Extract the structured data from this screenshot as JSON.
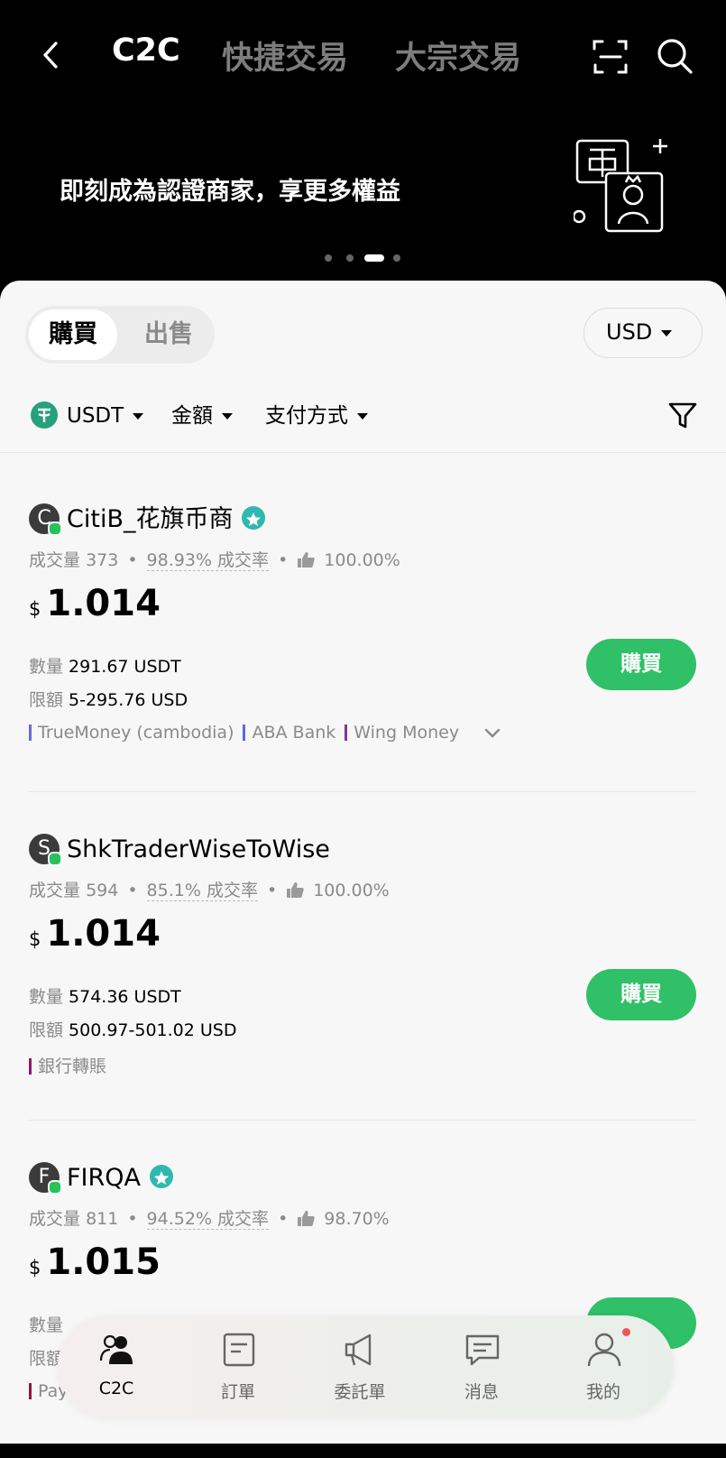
{
  "top_nav": {
    "tabs": [
      {
        "label": "C2C",
        "active": true
      },
      {
        "label": "快捷交易",
        "active": false
      },
      {
        "label": "大宗交易",
        "active": false
      }
    ]
  },
  "banner": {
    "text": "即刻成為認證商家，享更多權益",
    "pager": {
      "count": 4,
      "active_index": 2
    }
  },
  "trade_toggle": {
    "buy": "購買",
    "sell": "出售",
    "selected": "buy"
  },
  "currency_select": {
    "value": "USD"
  },
  "filters": {
    "coin": "USDT",
    "amount": "金額",
    "payment": "支付方式"
  },
  "offers": [
    {
      "avatar_letter": "C",
      "merchant": "CitiB_花旗币商",
      "verified": true,
      "trades_label": "成交量",
      "trades": "373",
      "completion": "98.93%",
      "completion_label": "成交率",
      "rating": "100.00%",
      "currency_symbol": "$",
      "price": "1.014",
      "quantity_label": "數量",
      "quantity": "291.67 USDT",
      "limit_label": "限額",
      "limit": "5-295.76 USD",
      "payments": [
        {
          "name": "TrueMoney (cambodia)",
          "color": "#6a6ad8"
        },
        {
          "name": "ABA Bank",
          "color": "#5a6ed6"
        },
        {
          "name": "Wing Money",
          "color": "#7a3a9a"
        }
      ],
      "expandable": true,
      "button": "購買"
    },
    {
      "avatar_letter": "S",
      "merchant": "ShkTraderWiseToWise",
      "verified": false,
      "trades_label": "成交量",
      "trades": "594",
      "completion": "85.1%",
      "completion_label": "成交率",
      "rating": "100.00%",
      "currency_symbol": "$",
      "price": "1.014",
      "quantity_label": "數量",
      "quantity": "574.36 USDT",
      "limit_label": "限額",
      "limit": "500.97-501.02 USD",
      "payments": [
        {
          "name": "銀行轉賬",
          "color": "#8a1a6a"
        }
      ],
      "expandable": false,
      "button": "購買"
    },
    {
      "avatar_letter": "F",
      "merchant": "FIRQA",
      "verified": true,
      "trades_label": "成交量",
      "trades": "811",
      "completion": "94.52%",
      "completion_label": "成交率",
      "rating": "98.70%",
      "currency_symbol": "$",
      "price": "1.015",
      "quantity_label": "數量",
      "quantity": "",
      "limit_label": "限額",
      "limit": "",
      "payments": [
        {
          "name": "Payoneer",
          "color": "#8a1a3a"
        }
      ],
      "expandable": false,
      "button": ""
    }
  ],
  "bottom_nav": [
    {
      "label": "C2C",
      "icon": "users-icon",
      "active": true
    },
    {
      "label": "訂單",
      "icon": "order-icon",
      "active": false
    },
    {
      "label": "委託單",
      "icon": "megaphone-icon",
      "active": false
    },
    {
      "label": "消息",
      "icon": "message-icon",
      "active": false
    },
    {
      "label": "我的",
      "icon": "profile-icon",
      "active": false,
      "badge": true
    }
  ],
  "colors": {
    "brand_green": "#30c067",
    "usdt": "#26a17b",
    "online": "#26c25a",
    "verified": "#2fb8b0"
  }
}
